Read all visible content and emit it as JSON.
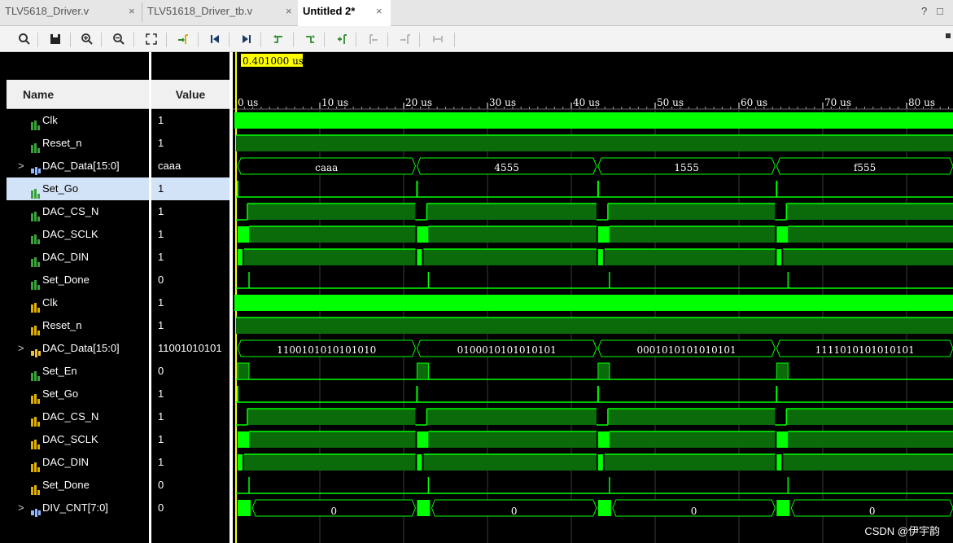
{
  "tabs": [
    {
      "label": "TLV5618_Driver.v",
      "close": "×"
    },
    {
      "label": "TLV51618_Driver_tb.v",
      "close": "×"
    },
    {
      "label": "Untitled 2*",
      "close": "×"
    }
  ],
  "window_controls": {
    "help": "?",
    "restore": "□"
  },
  "toolbar_icons": [
    "search-icon",
    "save-icon",
    "zoom-in-icon",
    "zoom-out-icon",
    "zoom-fit-icon",
    "go-to-cursor-icon",
    "go-to-start-icon",
    "go-to-end-icon",
    "previous-transition-icon",
    "next-transition-icon",
    "add-marker-icon",
    "previous-marker-icon",
    "next-marker-icon",
    "swap-cursors-icon"
  ],
  "columns": {
    "name": "Name",
    "value": "Value"
  },
  "cursor_time": "0.401000 us",
  "time_ticks": [
    "0 us",
    "10 us",
    "20 us",
    "30 us",
    "40 us",
    "50 us",
    "60 us",
    "70 us",
    "80 us"
  ],
  "signals": [
    {
      "name": "Clk",
      "value": "1",
      "icon": "bit",
      "expand": false
    },
    {
      "name": "Reset_n",
      "value": "1",
      "icon": "bit",
      "expand": false
    },
    {
      "name": "DAC_Data[15:0]",
      "value": "caaa",
      "icon": "bus",
      "expand": true
    },
    {
      "name": "Set_Go",
      "value": "1",
      "icon": "bit",
      "expand": false,
      "selected": true
    },
    {
      "name": "DAC_CS_N",
      "value": "1",
      "icon": "bit",
      "expand": false
    },
    {
      "name": "DAC_SCLK",
      "value": "1",
      "icon": "bit",
      "expand": false
    },
    {
      "name": "DAC_DIN",
      "value": "1",
      "icon": "bit",
      "expand": false
    },
    {
      "name": "Set_Done",
      "value": "0",
      "icon": "bit",
      "expand": false
    },
    {
      "name": "Clk",
      "value": "1",
      "icon": "bit2",
      "expand": false
    },
    {
      "name": "Reset_n",
      "value": "1",
      "icon": "bit2",
      "expand": false
    },
    {
      "name": "DAC_Data[15:0]",
      "value": "11001010101",
      "icon": "bus2",
      "expand": true
    },
    {
      "name": "Set_En",
      "value": "0",
      "icon": "bit",
      "expand": false
    },
    {
      "name": "Set_Go",
      "value": "1",
      "icon": "bit2",
      "expand": false
    },
    {
      "name": "DAC_CS_N",
      "value": "1",
      "icon": "bit2",
      "expand": false
    },
    {
      "name": "DAC_SCLK",
      "value": "1",
      "icon": "bit2",
      "expand": false
    },
    {
      "name": "DAC_DIN",
      "value": "1",
      "icon": "bit2",
      "expand": false
    },
    {
      "name": "Set_Done",
      "value": "0",
      "icon": "bit2",
      "expand": false
    },
    {
      "name": "DIV_CNT[7:0]",
      "value": "0",
      "icon": "bus",
      "expand": true
    }
  ],
  "bus_values": {
    "hex": [
      "caaa",
      "4555",
      "1555",
      "f555"
    ],
    "bin": [
      "1100101010101010",
      "0100010101010101",
      "0001010101010101",
      "1111010101010101"
    ],
    "div": [
      "0",
      "0",
      "0",
      "0"
    ]
  },
  "colors": {
    "wave": "#00ff00",
    "dim": "#0b6b0b",
    "grid": "#3a3a3a",
    "cursor": "#ffff00"
  },
  "watermark": "CSDN @伊宇韵"
}
